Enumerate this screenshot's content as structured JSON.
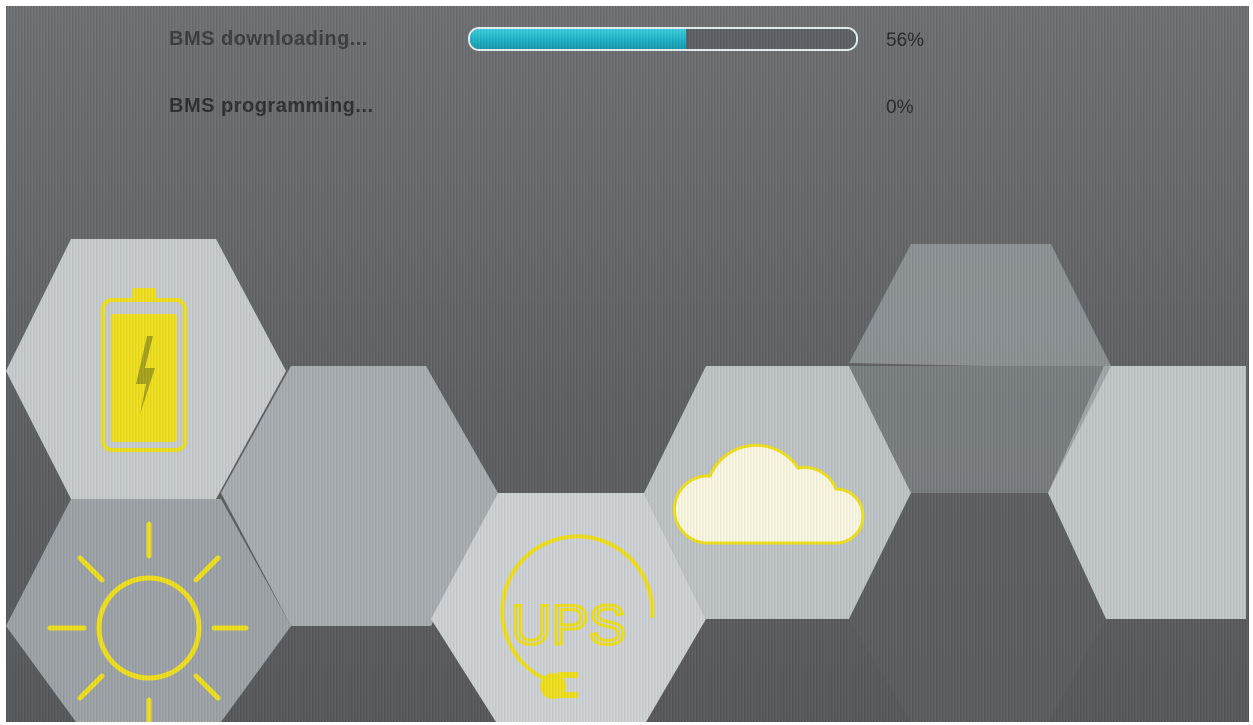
{
  "status": {
    "items": [
      {
        "label": "BMS downloading...",
        "percent": "56%",
        "progress": 0.56
      },
      {
        "label": "BMS programming...",
        "percent": "0%"
      }
    ]
  },
  "tiles": {
    "battery": {
      "icon": "battery-charging-icon"
    },
    "sun": {
      "icon": "sun-icon"
    },
    "ups": {
      "icon": "ups-plug-icon",
      "text": "UPS"
    },
    "cloud": {
      "icon": "cloud-icon"
    }
  },
  "colors": {
    "accent_yellow": "#f2e21c",
    "progress_cyan": "#22bfd2",
    "hex_light": "#c3c8cb",
    "hex_mid": "#a2a8ac"
  }
}
